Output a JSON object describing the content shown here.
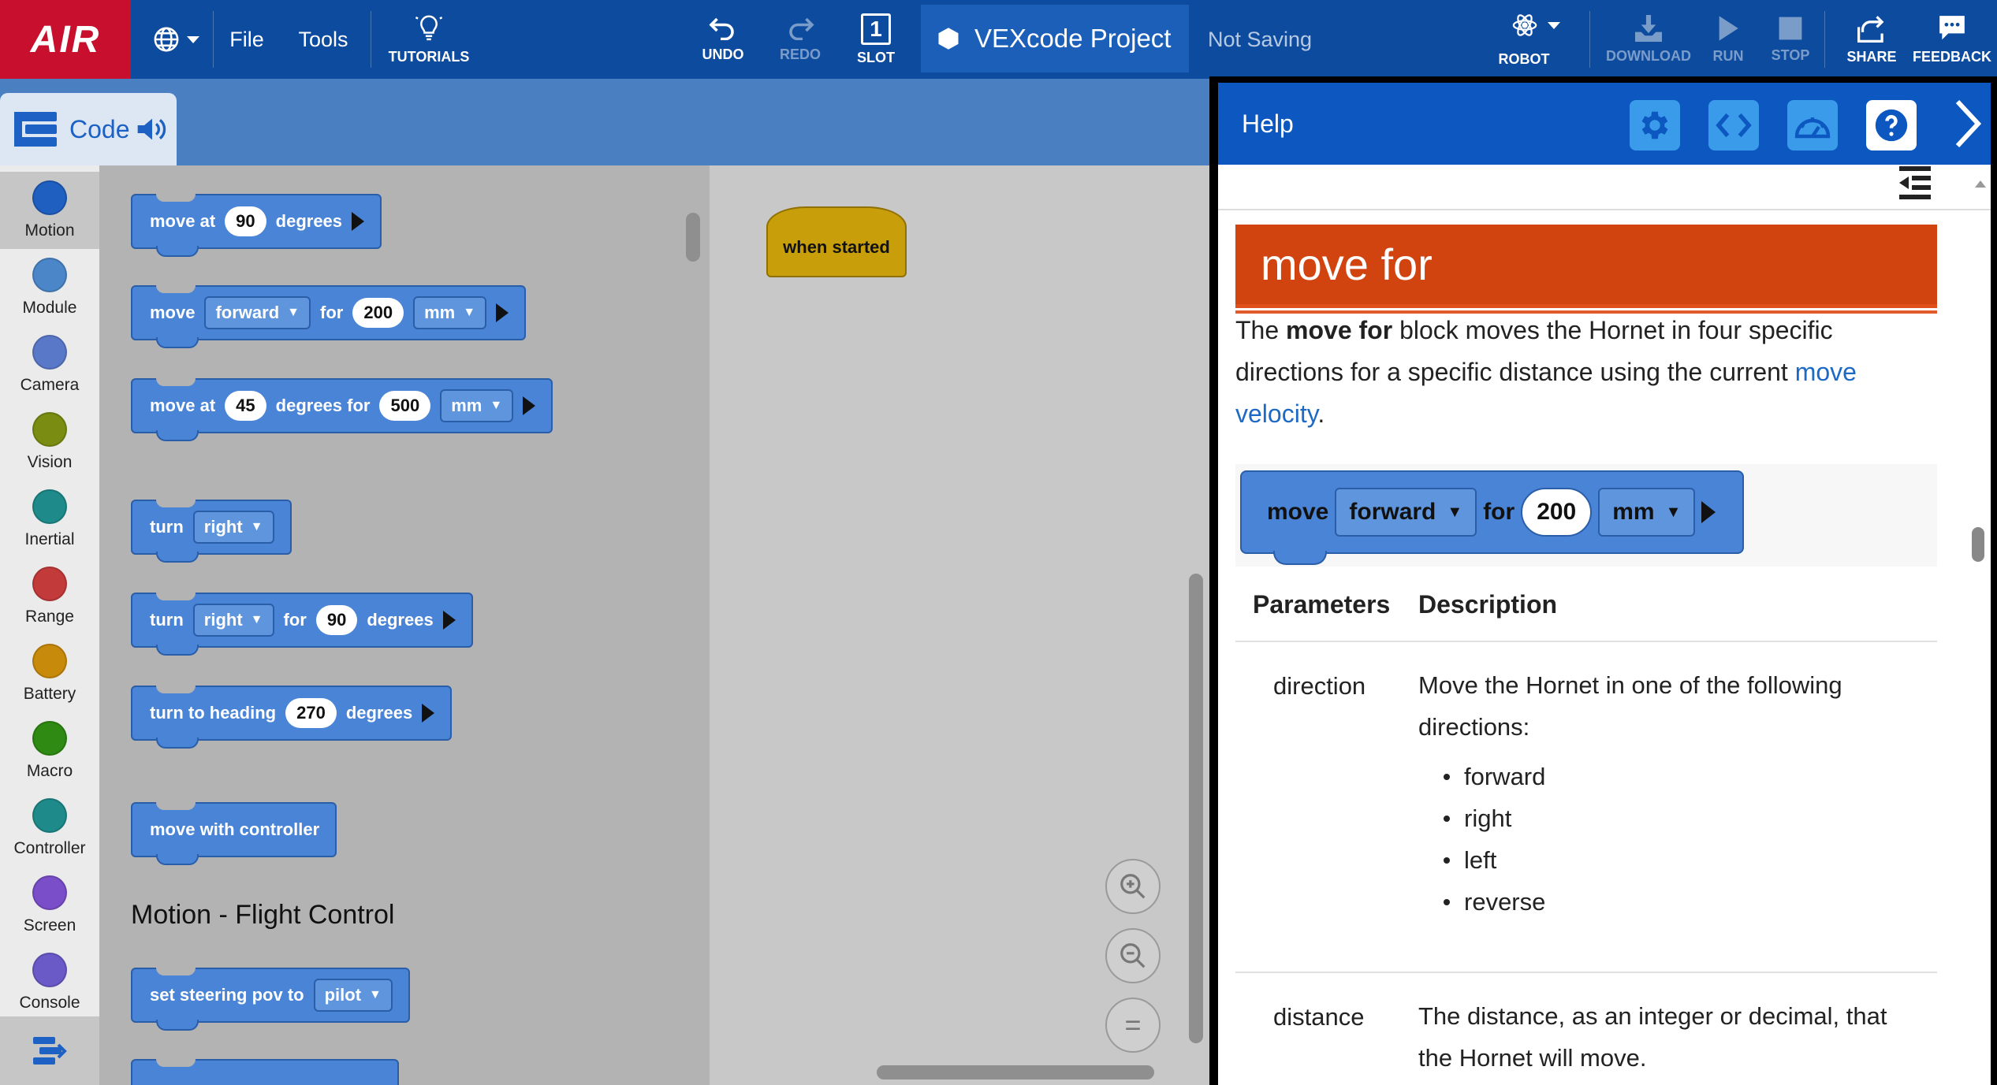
{
  "topbar": {
    "logo": "AIR",
    "file": "File",
    "tools": "Tools",
    "tutorials": "TUTORIALS",
    "undo": "UNDO",
    "redo": "REDO",
    "slot": "SLOT",
    "slot_number": "1",
    "project_name": "VEXcode Project",
    "save_status": "Not Saving",
    "robot": "ROBOT",
    "download": "DOWNLOAD",
    "run": "RUN",
    "stop": "STOP",
    "share": "SHARE",
    "feedback": "FEEDBACK"
  },
  "code_tab": {
    "label": "Code"
  },
  "categories": [
    {
      "label": "Motion",
      "color": "#1f5fc0"
    },
    {
      "label": "Module",
      "color": "#4a86c8"
    },
    {
      "label": "Camera",
      "color": "#5a78c8"
    },
    {
      "label": "Vision",
      "color": "#7a8c12"
    },
    {
      "label": "Inertial",
      "color": "#1e8a8a"
    },
    {
      "label": "Range",
      "color": "#c23a3a"
    },
    {
      "label": "Battery",
      "color": "#c88a0a"
    },
    {
      "label": "Macro",
      "color": "#2e8a12"
    },
    {
      "label": "Controller",
      "color": "#1e8a8a"
    },
    {
      "label": "Screen",
      "color": "#7a4ec8"
    },
    {
      "label": "Console",
      "color": "#6a5ac8"
    }
  ],
  "palette": {
    "blocks": {
      "move_at": {
        "label1": "move at",
        "angle": "90",
        "label2": "degrees"
      },
      "move_for": {
        "label1": "move",
        "direction": "forward",
        "label2": "for",
        "distance": "200",
        "unit": "mm"
      },
      "move_at_for": {
        "label1": "move at",
        "angle": "45",
        "label2": "degrees for",
        "distance": "500",
        "unit": "mm"
      },
      "turn": {
        "label1": "turn",
        "direction": "right"
      },
      "turn_for": {
        "label1": "turn",
        "direction": "right",
        "label2": "for",
        "angle": "90",
        "label3": "degrees"
      },
      "turn_heading": {
        "label1": "turn to heading",
        "angle": "270",
        "label2": "degrees"
      },
      "move_controller": {
        "label1": "move with controller"
      },
      "steering": {
        "label1": "set steering pov to",
        "value": "pilot"
      }
    },
    "section_title": "Motion - Flight Control"
  },
  "workspace": {
    "when_started": "when started",
    "zoom_reset": "="
  },
  "help": {
    "title": "Help",
    "banner": "move for",
    "desc": {
      "p1": "The ",
      "bold": "move for",
      "p2": " block moves the Hornet in four specific directions for a specific distance using the current ",
      "link": "move velocity",
      "p3": "."
    },
    "block": {
      "label1": "move",
      "direction": "forward",
      "label2": "for",
      "distance": "200",
      "unit": "mm"
    },
    "table": {
      "col1": "Parameters",
      "col2": "Description",
      "rows": [
        {
          "param": "direction",
          "desc": "Move the Hornet in one of the following directions:",
          "options": [
            "forward",
            "right",
            "left",
            "reverse"
          ]
        },
        {
          "param": "distance",
          "desc": "The distance, as an integer or decimal, that the Hornet will move."
        }
      ]
    }
  }
}
